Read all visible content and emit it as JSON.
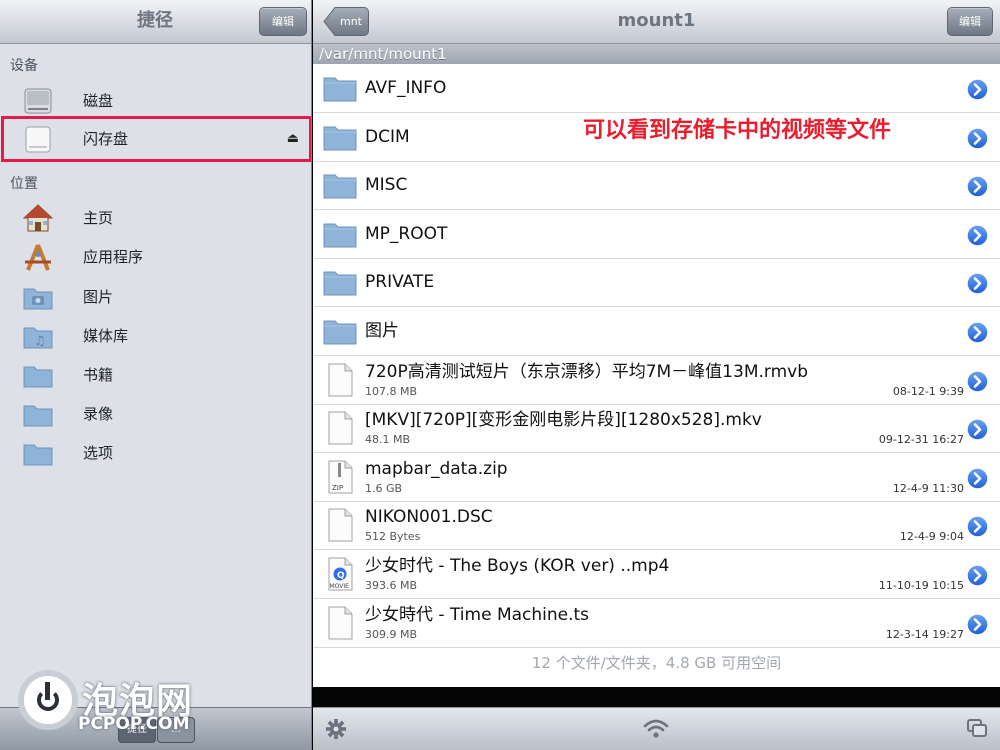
{
  "sidebar": {
    "title": "捷径",
    "edit_label": "编辑",
    "sections": [
      {
        "header": "设备",
        "items": [
          {
            "label": "磁盘",
            "icon": "hard-disk-icon"
          },
          {
            "label": "闪存盘",
            "icon": "flash-drive-icon",
            "eject": "⏏"
          }
        ]
      },
      {
        "header": "位置",
        "items": [
          {
            "label": "主页",
            "icon": "home-icon"
          },
          {
            "label": "应用程序",
            "icon": "applications-icon"
          },
          {
            "label": "图片",
            "icon": "pictures-folder-icon"
          },
          {
            "label": "媒体库",
            "icon": "music-folder-icon"
          },
          {
            "label": "书籍",
            "icon": "folder-icon"
          },
          {
            "label": "录像",
            "icon": "folder-icon"
          },
          {
            "label": "选项",
            "icon": "folder-icon"
          }
        ]
      }
    ],
    "bottom_tabs": [
      "捷径",
      "…"
    ]
  },
  "main": {
    "title": "mount1",
    "back_label": "mnt",
    "edit_label": "编辑",
    "path": "/var/mnt/mount1",
    "items": [
      {
        "name": "AVF_INFO",
        "type": "folder"
      },
      {
        "name": "DCIM",
        "type": "folder"
      },
      {
        "name": "MISC",
        "type": "folder"
      },
      {
        "name": "MP_ROOT",
        "type": "folder"
      },
      {
        "name": "PRIVATE",
        "type": "folder"
      },
      {
        "name": "图片",
        "type": "folder"
      },
      {
        "name": "720P高清测试短片（东京漂移）平均7M－峰值13M.rmvb",
        "type": "file",
        "size": "107.8 MB",
        "date": "08-12-1 9:39"
      },
      {
        "name": "[MKV][720P][变形金刚电影片段][1280x528].mkv",
        "type": "file",
        "size": "48.1 MB",
        "date": "09-12-31 16:27"
      },
      {
        "name": "mapbar_data.zip",
        "type": "zip",
        "size": "1.6 GB",
        "date": "12-4-9 11:30"
      },
      {
        "name": "NIKON001.DSC",
        "type": "file",
        "size": "512 Bytes",
        "date": "12-4-9 9:04"
      },
      {
        "name": "少女时代 - The Boys (KOR ver) ..mp4",
        "type": "movie",
        "size": "393.6 MB",
        "date": "11-10-19 10:15"
      },
      {
        "name": "少女時代 - Time Machine.ts",
        "type": "file",
        "size": "309.9 MB",
        "date": "12-3-14 19:27"
      }
    ],
    "footer": "12 个文件/文件夹，4.8 GB 可用空间",
    "annotation": "可以看到存储卡中的视频等文件"
  },
  "watermark": {
    "cn": "泡泡网",
    "en": "PCPOP.COM"
  },
  "colors": {
    "annotation": "#ea1d2c",
    "highlight": "#e11b4a",
    "disclosure": "#2f6fe0",
    "folder": "#8fb3d9"
  }
}
